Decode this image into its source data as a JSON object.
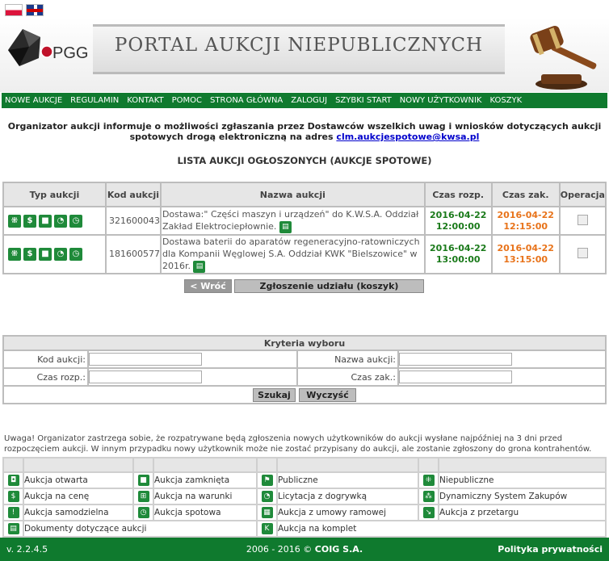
{
  "header": {
    "title": "PORTAL AUKCJI NIEPUBLICZNYCH",
    "logo_text": "PGG",
    "languages": [
      "pl",
      "en"
    ]
  },
  "nav": [
    "NOWE AUKCJE",
    "REGULAMIN",
    "KONTAKT",
    "POMOC",
    "STRONA GŁÓWNA",
    "ZALOGUJ",
    "SZYBKI START",
    "NOWY UŻYTKOWNIK",
    "KOSZYK"
  ],
  "notice": {
    "text": "Organizator aukcji informuje o możliwości zgłaszania przez Dostawców wszelkich uwag i wniosków dotyczących aukcji spotowych drogą elektroniczną na adres",
    "email": "clm.aukcjespotowe@kwsa.pl"
  },
  "list_title": "LISTA AUKCJI OGŁOSZONYCH (AUKCJE SPOTOWE)",
  "table": {
    "headers": [
      "Typ aukcji",
      "Kod aukcji",
      "Nazwa aukcji",
      "Czas rozp.",
      "Czas zak.",
      "Operacja"
    ],
    "rows": [
      {
        "code": "321600043",
        "name": "Dostawa:\" Części maszyn i urządzeń\" do K.W.S.A. Oddział Zakład Elektrociepłownie.",
        "start_date": "2016-04-22",
        "start_time": "12:00:00",
        "end_date": "2016-04-22",
        "end_time": "12:15:00"
      },
      {
        "code": "181600577",
        "name": "Dostawa baterii do aparatów regeneracyjno-ratowniczych dla Kompanii Węglowej S.A. Oddział KWK \"Bielszowice\" w 2016r.",
        "start_date": "2016-04-22",
        "start_time": "13:00:00",
        "end_date": "2016-04-22",
        "end_time": "13:15:00"
      }
    ]
  },
  "buttons": {
    "back": "< Wróć",
    "join": "Zgłoszenie udziału (koszyk)",
    "search": "Szukaj",
    "clear": "Wyczyść"
  },
  "criteria": {
    "title": "Kryteria wyboru",
    "code_label": "Kod aukcji:",
    "name_label": "Nazwa aukcji:",
    "start_label": "Czas rozp.:",
    "end_label": "Czas zak.:"
  },
  "warning": "Uwaga! Organizator zastrzega sobie, że rozpatrywane będą zgłoszenia nowych użytkowników do aukcji wysłane najpóźniej na 3 dni przed rozpoczęciem aukcji. W innym przypadku nowy użytkownik może nie zostać przypisany do aukcji, ale zostanie zgłoszony do grona kontrahentów.",
  "legend": [
    [
      "Aukcja otwarta",
      "Aukcja zamknięta",
      "Publiczne",
      "Niepubliczne"
    ],
    [
      "Aukcja na cenę",
      "Aukcja na warunki",
      "Licytacja z dogrywką",
      "Dynamiczny System Zakupów"
    ],
    [
      "Aukcja samodzielna",
      "Aukcja spotowa",
      "Aukcja z umowy ramowej",
      "Aukcja z przetargu"
    ],
    [
      "Dokumenty dotyczące aukcji",
      "",
      "Aukcja na komplet",
      ""
    ]
  ],
  "footer": {
    "version": "v. 2.2.4.5",
    "copyright": "2006 - 2016 ©",
    "company": "COIG S.A.",
    "privacy": "Polityka prywatności"
  },
  "colors": {
    "primary_green": "#0f7a2e",
    "start_time": "#1a7a1a",
    "end_time": "#e8731a"
  }
}
